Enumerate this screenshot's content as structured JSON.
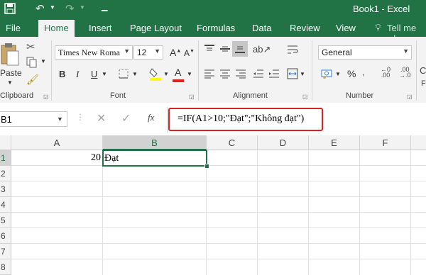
{
  "title_bar": {
    "document_title": "Book1 - Excel"
  },
  "tabs": [
    "File",
    "Home",
    "Insert",
    "Page Layout",
    "Formulas",
    "Data",
    "Review",
    "View"
  ],
  "tell_me": "Tell me wh",
  "ribbon": {
    "clipboard": {
      "paste_label": "Paste",
      "group_label": "Clipboard"
    },
    "font": {
      "font_name": "Times New Roma",
      "font_size": "12",
      "group_label": "Font",
      "bold": "B",
      "italic": "I",
      "underline": "U",
      "font_color_glyph": "A"
    },
    "alignment": {
      "group_label": "Alignment"
    },
    "number": {
      "format": "General",
      "group_label": "Number",
      "percent": "%"
    }
  },
  "formula_bar": {
    "name_box": "B1",
    "fx_label": "fx",
    "formula": "=IF(A1>10;\"Đạt\";\"Không đạt\")"
  },
  "grid": {
    "columns": [
      "A",
      "B",
      "C",
      "D",
      "E",
      "F"
    ],
    "rows": [
      "1",
      "2",
      "3",
      "4",
      "5",
      "6",
      "7",
      "8"
    ],
    "selected_cell": "B1",
    "cells": {
      "A1": "20",
      "B1": "Đạt"
    }
  },
  "colors": {
    "accent": "#217346",
    "highlight": "#d92121",
    "selection_header": "#a9d5b8"
  }
}
